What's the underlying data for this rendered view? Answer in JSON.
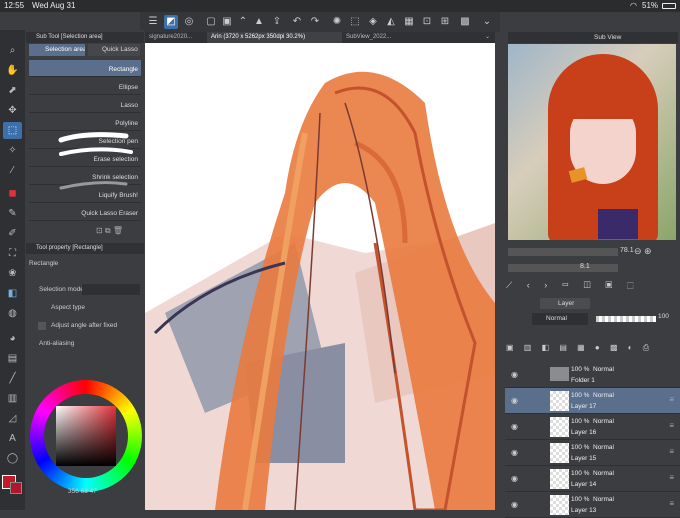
{
  "status": {
    "time": "12:55",
    "date": "Wed Aug 31",
    "battery": "51%"
  },
  "tabs": [
    "signature2020...",
    "Arin (3720 x 5262px 350dpi 30.2%)",
    "SubView_2022..."
  ],
  "subtool": {
    "header": "Sub Tool [Selection area]",
    "tab1": "Selection area",
    "tab2": "Quick Lasso",
    "items": [
      "Rectangle",
      "Ellipse",
      "Lasso",
      "Polyline",
      "Selection pen",
      "Erase selection",
      "Shrink selection",
      "Liquify Brush!",
      "Quick Lasso Eraser"
    ]
  },
  "toolprop": {
    "header": "Tool property [Rectangle]",
    "title": "Rectangle",
    "selection_mode": "Selection mode",
    "aspect": "Aspect type",
    "adjust": "Adjust angle after fixed",
    "antialias": "Anti-aliasing"
  },
  "color": {
    "values": "356 63 47",
    "accent": "#d6212b",
    "main": "#c41a28",
    "sub": "#b0162c"
  },
  "subview": {
    "title": "Sub View",
    "zoom": "78.1",
    "rotate": "8.1"
  },
  "layerpanel": {
    "tab": "Layer",
    "blend": "Normal",
    "opacity": "100",
    "layers": [
      {
        "pct": "100 %",
        "mode": "Normal",
        "name": "Folder 1"
      },
      {
        "pct": "100 %",
        "mode": "Normal",
        "name": "Layer 17"
      },
      {
        "pct": "100 %",
        "mode": "Normal",
        "name": "Layer 16"
      },
      {
        "pct": "100 %",
        "mode": "Normal",
        "name": "Layer 15"
      },
      {
        "pct": "100 %",
        "mode": "Normal",
        "name": "Layer 14"
      },
      {
        "pct": "100 %",
        "mode": "Normal",
        "name": "Layer 13"
      }
    ]
  }
}
